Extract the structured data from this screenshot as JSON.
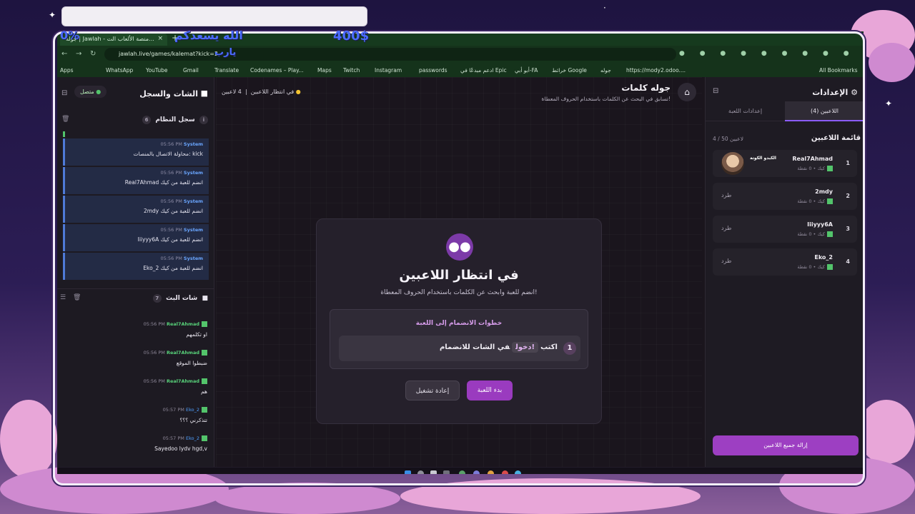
{
  "overlay": {
    "money": "400$",
    "percent": "0%",
    "prayer_line1": "الله يسعدكم",
    "prayer_line2": "يارب"
  },
  "browser": {
    "tab_title": "جولة | Jawlah - منصة الألعاب الت...",
    "new_tab": "+",
    "url": "jawlah.live/games/kalemat?kick=2",
    "bookmarks": [
      "Apps",
      "WhatsApp",
      "YouTube",
      "Gmail",
      "Translate",
      "Codenames – Play...",
      "Maps",
      "Twitch",
      "Instagram",
      "passwords",
      "ادعم مبدعًا في Epic",
      "أبو أبي-FA",
      "خرائط Google",
      "جوله",
      "https://mody2.odoo...."
    ],
    "all_bookmarks": "All Bookmarks"
  },
  "left_panel": {
    "title": "الشات والسجل",
    "status": "متصل",
    "system_log": {
      "label": "سجل النظام",
      "count": "6",
      "items": [
        {
          "sender": "System",
          "time": "05:56 PM",
          "text": "محاولة الاتصال بالمنصات: kick"
        },
        {
          "sender": "System",
          "time": "05:56 PM",
          "text": "Real7Ahmad انضم للعبة من كيك"
        },
        {
          "sender": "System",
          "time": "05:56 PM",
          "text": "2mdy انضم للعبة من كيك"
        },
        {
          "sender": "System",
          "time": "05:56 PM",
          "text": "Iiiyyy6A انضم للعبة من كيك"
        },
        {
          "sender": "System",
          "time": "05:56 PM",
          "text": "Eko_2 انضم للعبة من كيك"
        }
      ]
    },
    "live_chat": {
      "label": "شات البث",
      "count": "7",
      "items": [
        {
          "user": "Real7Ahmad",
          "time": "05:56 PM",
          "text": "او تكلمهم"
        },
        {
          "user": "Real7Ahmad",
          "time": "05:56 PM",
          "text": "ضبطوا الموقع"
        },
        {
          "user": "Real7Ahmad",
          "time": "05:56 PM",
          "text": "هم"
        },
        {
          "user": "Eko_2",
          "time": "05:57 PM",
          "text": "تتذكرني ؟؟؟"
        },
        {
          "user": "Eko_2",
          "time": "05:57 PM",
          "text": "Sayedoo lydv hgd,v"
        }
      ]
    }
  },
  "center": {
    "game_title": "جوله كلمات",
    "game_subtitle": "تسابق في البحث عن الكلمات باستخدام الحروف المعطاة!",
    "status_waiting": "في انتظار اللاعبين",
    "players_count": "4 لاعبين",
    "modal": {
      "title": "في انتظار اللاعبين",
      "subtitle": "انضم للعبة وابحث عن الكلمات باستخدام الحروف المعطاة!",
      "steps_title": "خطوات الانضمام إلى اللعبة",
      "step_number": "1",
      "step_prefix": "اكتب",
      "step_keyword": "!دخول",
      "step_suffix": "في الشات للانضمام",
      "start_button": "بدء اللعبة",
      "restart_button": "إعادة تشغيل"
    }
  },
  "right_panel": {
    "title": "الإعدادات",
    "tab_players": "اللاعبين (4)",
    "tab_settings": "إعدادات اللعبة",
    "list_title": "قائمة اللاعبين",
    "list_count": "4 / 50 لاعبين",
    "players": [
      {
        "rank": "1",
        "name": "Real7Ahmad",
        "meta": "كيك • 0 نقطة",
        "tag": "الكبدو الكوتة"
      },
      {
        "rank": "2",
        "name": "2mdy",
        "meta": "كيك • 0 نقطة",
        "kick": "طرد"
      },
      {
        "rank": "3",
        "name": "Iiiyyy6A",
        "meta": "كيك • 0 نقطة",
        "kick": "طرد"
      },
      {
        "rank": "4",
        "name": "Eko_2",
        "meta": "كيك • 0 نقطة",
        "kick": "طرد"
      }
    ],
    "remove_all": "إزالة جميع اللاعبين"
  },
  "colors": {
    "accent": "#9a3bbf",
    "online": "#53c46b",
    "system": "#4f7ad8"
  }
}
